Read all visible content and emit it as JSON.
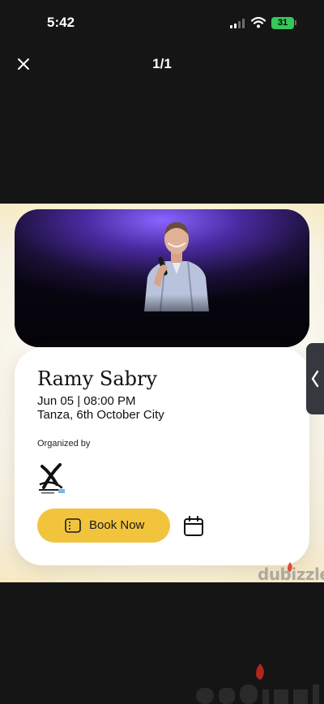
{
  "status_bar": {
    "time": "5:42",
    "battery": "31"
  },
  "viewer": {
    "page_counter": "1/1"
  },
  "event": {
    "title": "Ramy Sabry",
    "datetime": "Jun 05 | 08:00 PM",
    "venue": "Tanza, 6th October City",
    "organized_label": "Organized by",
    "book_label": "Book Now"
  },
  "watermark": {
    "text": "dubizzle"
  },
  "colors": {
    "background": "#151515",
    "book_button": "#f2c43e",
    "battery": "#34c759",
    "side_tab": "#35383f",
    "hero_purple": "#8a64ff"
  },
  "icons": [
    "close-icon",
    "signal-icon",
    "wifi-icon",
    "battery-icon",
    "ticket-icon",
    "calendar-icon",
    "chevron-left-icon",
    "flame-icon",
    "organizer-logo"
  ]
}
